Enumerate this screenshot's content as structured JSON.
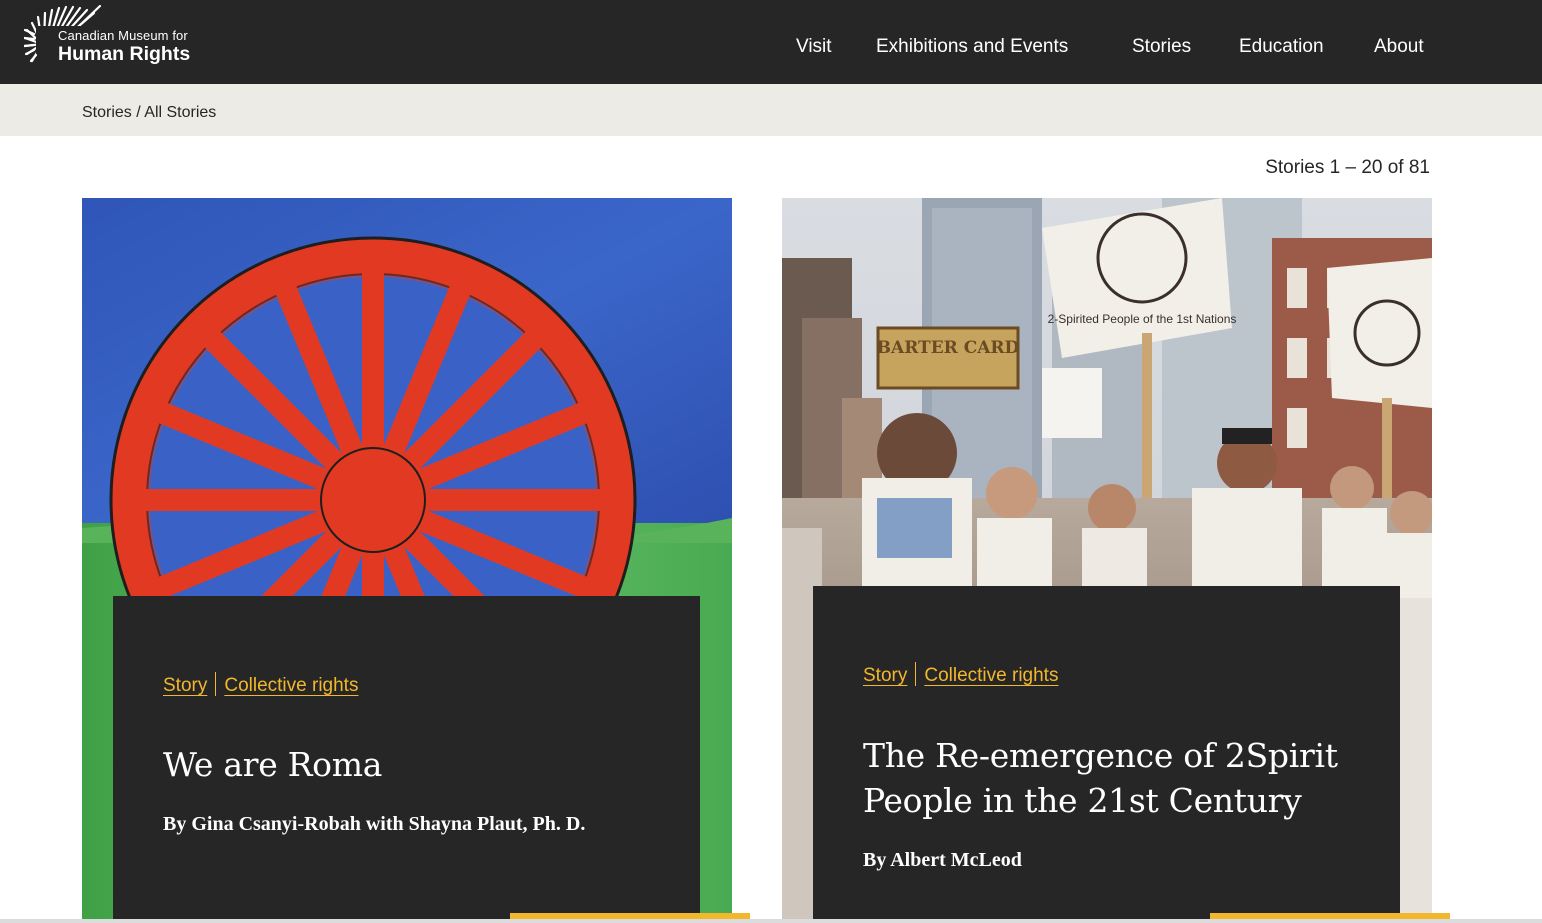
{
  "header": {
    "logo_line1": "Canadian Museum for",
    "logo_line2": "Human Rights",
    "nav": [
      "Visit",
      "Exhibitions and Events",
      "Stories",
      "Education",
      "About"
    ]
  },
  "breadcrumb": {
    "root": "Stories",
    "separator": "/",
    "current": "All Stories"
  },
  "results_count": "Stories 1 – 20 of 81",
  "cards": [
    {
      "image": "roma-wheel-painting",
      "tag_type": "Story",
      "tag_topic": "Collective rights",
      "title": "We are Roma",
      "byline": "By Gina Csanyi-Robah with Shayna Plaut, Ph. D."
    },
    {
      "image": "two-spirit-parade-photo",
      "tag_type": "Story",
      "tag_topic": "Collective rights",
      "title": "The Re-emergence of 2Spirit People in the 21st Century",
      "byline": "By Albert McLeod",
      "photo_texts": {
        "billboard": "BARTER CARD",
        "sign1": "2-Spirited People of the 1st Nations",
        "sign2": "2-Spirited People of the 1st Nations"
      }
    }
  ],
  "colors": {
    "header_bg": "#262626",
    "accent": "#f3b72b",
    "breadcrumb_bg": "#ecebe6"
  }
}
